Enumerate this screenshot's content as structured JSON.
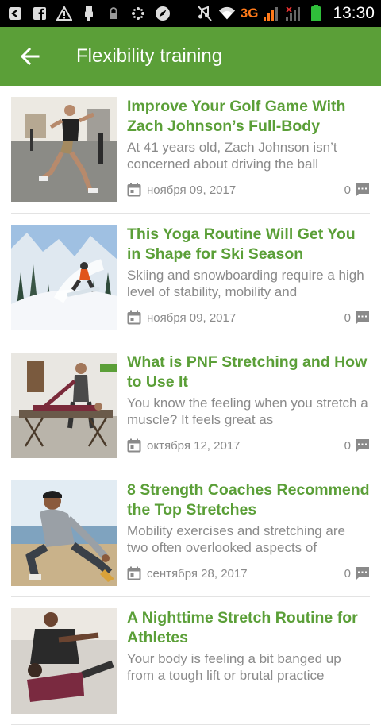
{
  "status_bar": {
    "network": "3G",
    "time": "13:30",
    "icons": [
      "back-arrow-icon",
      "facebook-icon",
      "warning-icon",
      "usb-icon",
      "lock-icon",
      "dots-icon",
      "location-icon",
      "mute-icon",
      "wifi-icon",
      "signal-icon",
      "battery-icon"
    ]
  },
  "app_bar": {
    "title": "Flexibility training",
    "back_icon": "back-arrow-icon",
    "color": "#5b9f38"
  },
  "articles": [
    {
      "title": "Improve Your Golf Game With Zach Johnson’s Full-Body",
      "excerpt": "At 41 years old, Zach Johnson isn’t concerned about driving the ball",
      "date": "ноября 09, 2017",
      "comments": "0",
      "thumb": "gym-lunge"
    },
    {
      "title": "This Yoga Routine Will Get You in Shape for Ski Season",
      "excerpt": "Skiing and snowboarding require a high level of stability, mobility and",
      "date": "ноября 09, 2017",
      "comments": "0",
      "thumb": "snowboarder"
    },
    {
      "title": "What is PNF Stretching and How to Use It",
      "excerpt": "You know the feeling when you stretch a muscle? It feels great as",
      "date": "октября 12, 2017",
      "comments": "0",
      "thumb": "table-stretch"
    },
    {
      "title": "8 Strength Coaches Recommend the Top Stretches",
      "excerpt": "Mobility exercises and stretching are two often overlooked aspects of",
      "date": "сентября 28, 2017",
      "comments": "0",
      "thumb": "beach-stretch"
    },
    {
      "title": "A Nighttime Stretch Routine for Athletes",
      "excerpt": "Your body is feeling a bit banged up from a tough lift or brutal practice",
      "date": "",
      "comments": "",
      "thumb": "partner-stretch"
    }
  ]
}
